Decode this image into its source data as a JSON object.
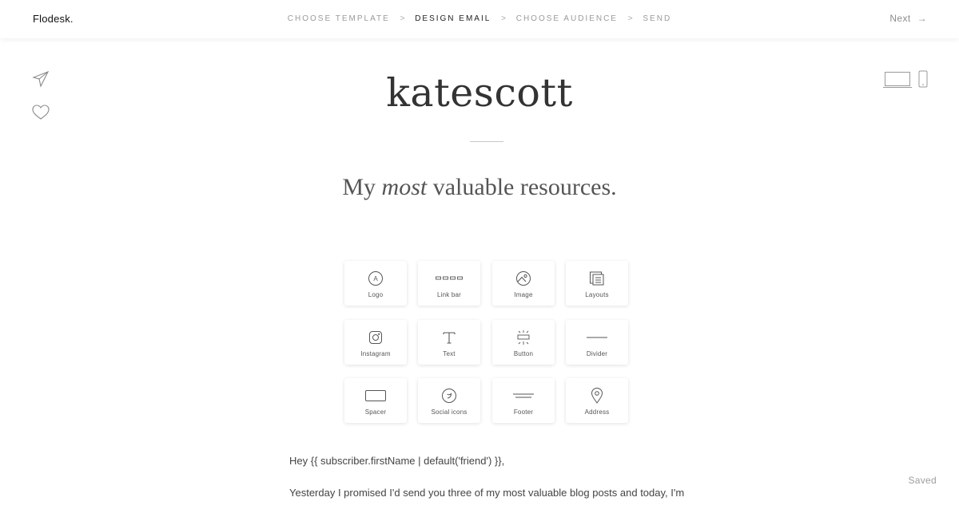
{
  "app": {
    "name": "Flodesk."
  },
  "steps": [
    {
      "label": "CHOOSE TEMPLATE",
      "active": false
    },
    {
      "label": "DESIGN EMAIL",
      "active": true
    },
    {
      "label": "CHOOSE AUDIENCE",
      "active": false
    },
    {
      "label": "SEND",
      "active": false
    }
  ],
  "step_separator": ">",
  "header": {
    "next_label": "Next",
    "next_arrow": "→"
  },
  "email": {
    "brand": "katescott",
    "headline_before": "My ",
    "headline_em": "most",
    "headline_after": " valuable resources.",
    "body_lines": [
      "Hey {{ subscriber.firstName | default('friend') }},",
      "Yesterday I promised I'd send you three of my most valuable blog posts and today, I'm"
    ]
  },
  "blocks": [
    {
      "label": "Logo",
      "icon": "logo-icon"
    },
    {
      "label": "Link bar",
      "icon": "link-bar-icon"
    },
    {
      "label": "Image",
      "icon": "image-icon"
    },
    {
      "label": "Layouts",
      "icon": "layouts-icon"
    },
    {
      "label": "Instagram",
      "icon": "instagram-icon"
    },
    {
      "label": "Text",
      "icon": "text-icon"
    },
    {
      "label": "Button",
      "icon": "button-icon"
    },
    {
      "label": "Divider",
      "icon": "divider-icon"
    },
    {
      "label": "Spacer",
      "icon": "spacer-icon"
    },
    {
      "label": "Social icons",
      "icon": "social-icons-icon"
    },
    {
      "label": "Footer",
      "icon": "footer-icon"
    },
    {
      "label": "Address",
      "icon": "address-icon"
    }
  ],
  "status": {
    "saved_label": "Saved"
  },
  "colors": {
    "accent": "#222222",
    "muted": "#9a9a9a"
  }
}
